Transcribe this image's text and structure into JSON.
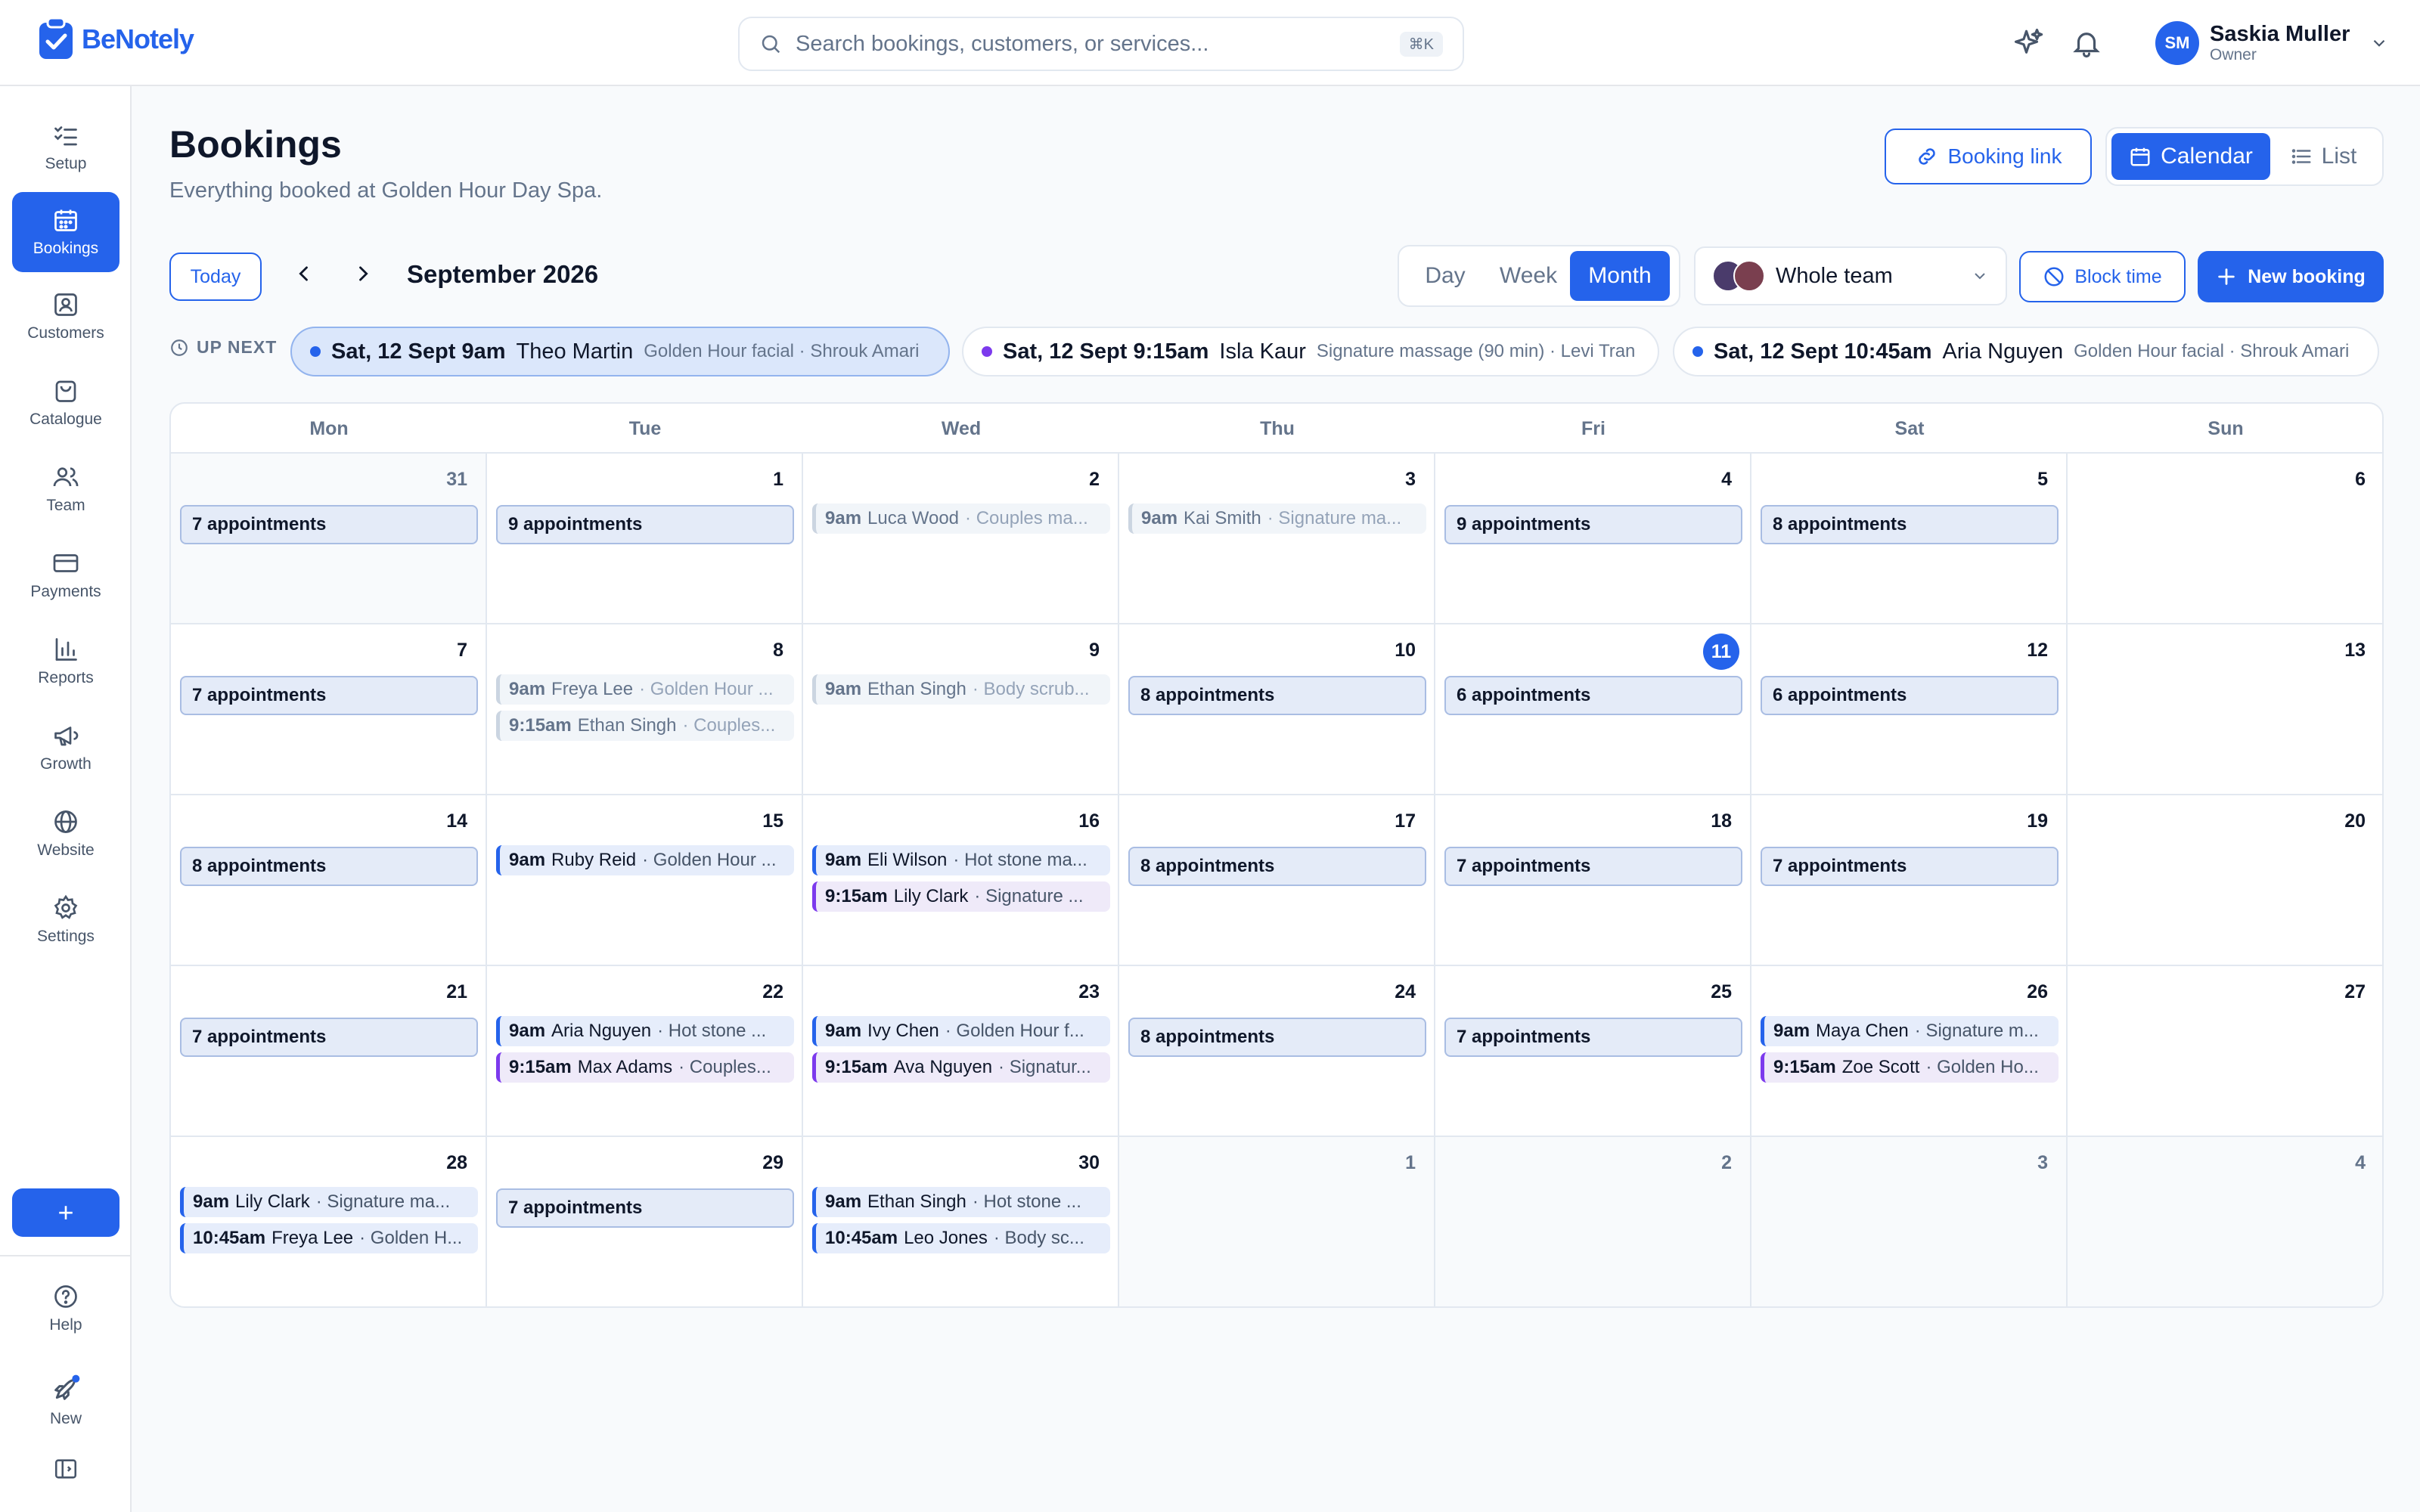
{
  "app": {
    "name": "BeNotely"
  },
  "search": {
    "placeholder": "Search bookings, customers, or services...",
    "shortcut": "⌘K"
  },
  "user": {
    "initials": "SM",
    "name": "Saskia Muller",
    "role": "Owner"
  },
  "sidebar": {
    "items": [
      {
        "label": "Setup",
        "icon": "checklist-icon"
      },
      {
        "label": "Bookings",
        "icon": "calendar-icon",
        "active": true
      },
      {
        "label": "Customers",
        "icon": "contact-card-icon"
      },
      {
        "label": "Catalogue",
        "icon": "shopping-bag-icon"
      },
      {
        "label": "Team",
        "icon": "users-icon"
      },
      {
        "label": "Payments",
        "icon": "credit-card-icon"
      },
      {
        "label": "Reports",
        "icon": "bar-chart-icon"
      },
      {
        "label": "Growth",
        "icon": "megaphone-icon"
      },
      {
        "label": "Website",
        "icon": "globe-icon"
      },
      {
        "label": "Settings",
        "icon": "gear-icon"
      }
    ],
    "add_label": "+",
    "help_label": "Help",
    "new_label": "New"
  },
  "header": {
    "title": "Bookings",
    "subtitle": "Everything booked at Golden Hour Day Spa.",
    "booking_link": "Booking link",
    "view_calendar": "Calendar",
    "view_list": "List"
  },
  "toolbar": {
    "today": "Today",
    "month_label": "September 2026",
    "views": [
      "Day",
      "Week",
      "Month"
    ],
    "active_view": "Month",
    "team": "Whole team",
    "block_time": "Block time",
    "new_booking": "New booking"
  },
  "up_next": {
    "label": "UP NEXT",
    "items": [
      {
        "when": "Sat, 12 Sept 9am",
        "customer": "Theo Martin",
        "details": "Golden Hour facial · Shrouk Amari",
        "dot": "#2563eb"
      },
      {
        "when": "Sat, 12 Sept 9:15am",
        "customer": "Isla Kaur",
        "details": "Signature massage (90 min) · Levi Tran",
        "dot": "#7c3aed"
      },
      {
        "when": "Sat, 12 Sept 10:45am",
        "customer": "Aria Nguyen",
        "details": "Golden Hour facial · Shrouk Amari",
        "dot": "#2563eb"
      }
    ]
  },
  "calendar": {
    "weekdays": [
      "Mon",
      "Tue",
      "Wed",
      "Thu",
      "Fri",
      "Sat",
      "Sun"
    ],
    "days": [
      {
        "n": "31",
        "muted": true,
        "count": "7 appointments"
      },
      {
        "n": "1",
        "count": "9 appointments"
      },
      {
        "n": "2",
        "appts": [
          {
            "t": "9am",
            "name": "Luca Wood",
            "svc": "· Couples ma...",
            "past": true
          }
        ]
      },
      {
        "n": "3",
        "appts": [
          {
            "t": "9am",
            "name": "Kai Smith",
            "svc": "· Signature ma...",
            "past": true
          }
        ]
      },
      {
        "n": "4",
        "count": "9 appointments"
      },
      {
        "n": "5",
        "count": "8 appointments"
      },
      {
        "n": "6"
      },
      {
        "n": "7",
        "count": "7 appointments"
      },
      {
        "n": "8",
        "appts": [
          {
            "t": "9am",
            "name": "Freya Lee",
            "svc": "· Golden Hour ...",
            "past": true
          },
          {
            "t": "9:15am",
            "name": "Ethan Singh",
            "svc": "· Couples...",
            "past": true
          }
        ]
      },
      {
        "n": "9",
        "appts": [
          {
            "t": "9am",
            "name": "Ethan Singh",
            "svc": "· Body scrub...",
            "past": true
          }
        ]
      },
      {
        "n": "10",
        "count": "8 appointments"
      },
      {
        "n": "11",
        "today": true,
        "count": "6 appointments"
      },
      {
        "n": "12",
        "count": "6 appointments"
      },
      {
        "n": "13"
      },
      {
        "n": "14",
        "count": "8 appointments"
      },
      {
        "n": "15",
        "appts": [
          {
            "t": "9am",
            "name": "Ruby Reid",
            "svc": "· Golden Hour ..."
          }
        ]
      },
      {
        "n": "16",
        "appts": [
          {
            "t": "9am",
            "name": "Eli Wilson",
            "svc": "· Hot stone ma..."
          },
          {
            "t": "9:15am",
            "name": "Lily Clark",
            "svc": "· Signature ...",
            "purple": true
          }
        ]
      },
      {
        "n": "17",
        "count": "8 appointments"
      },
      {
        "n": "18",
        "count": "7 appointments"
      },
      {
        "n": "19",
        "count": "7 appointments"
      },
      {
        "n": "20"
      },
      {
        "n": "21",
        "count": "7 appointments"
      },
      {
        "n": "22",
        "appts": [
          {
            "t": "9am",
            "name": "Aria Nguyen",
            "svc": "· Hot stone ..."
          },
          {
            "t": "9:15am",
            "name": "Max Adams",
            "svc": "· Couples...",
            "purple": true
          }
        ]
      },
      {
        "n": "23",
        "appts": [
          {
            "t": "9am",
            "name": "Ivy Chen",
            "svc": "· Golden Hour f..."
          },
          {
            "t": "9:15am",
            "name": "Ava Nguyen",
            "svc": "· Signatur...",
            "purple": true
          }
        ]
      },
      {
        "n": "24",
        "count": "8 appointments"
      },
      {
        "n": "25",
        "count": "7 appointments"
      },
      {
        "n": "26",
        "appts": [
          {
            "t": "9am",
            "name": "Maya Chen",
            "svc": "· Signature m..."
          },
          {
            "t": "9:15am",
            "name": "Zoe Scott",
            "svc": "· Golden Ho...",
            "purple": true
          }
        ]
      },
      {
        "n": "27"
      },
      {
        "n": "28",
        "appts": [
          {
            "t": "9am",
            "name": "Lily Clark",
            "svc": "· Signature ma..."
          },
          {
            "t": "10:45am",
            "name": "Freya Lee",
            "svc": "· Golden H..."
          }
        ]
      },
      {
        "n": "29",
        "count": "7 appointments"
      },
      {
        "n": "30",
        "appts": [
          {
            "t": "9am",
            "name": "Ethan Singh",
            "svc": "· Hot stone ..."
          },
          {
            "t": "10:45am",
            "name": "Leo Jones",
            "svc": "· Body sc..."
          }
        ]
      },
      {
        "n": "1",
        "muted": true
      },
      {
        "n": "2",
        "muted": true
      },
      {
        "n": "3",
        "muted": true
      },
      {
        "n": "4",
        "muted": true
      }
    ]
  },
  "colors": {
    "accent": "#2563eb",
    "purple": "#7c3aed"
  }
}
